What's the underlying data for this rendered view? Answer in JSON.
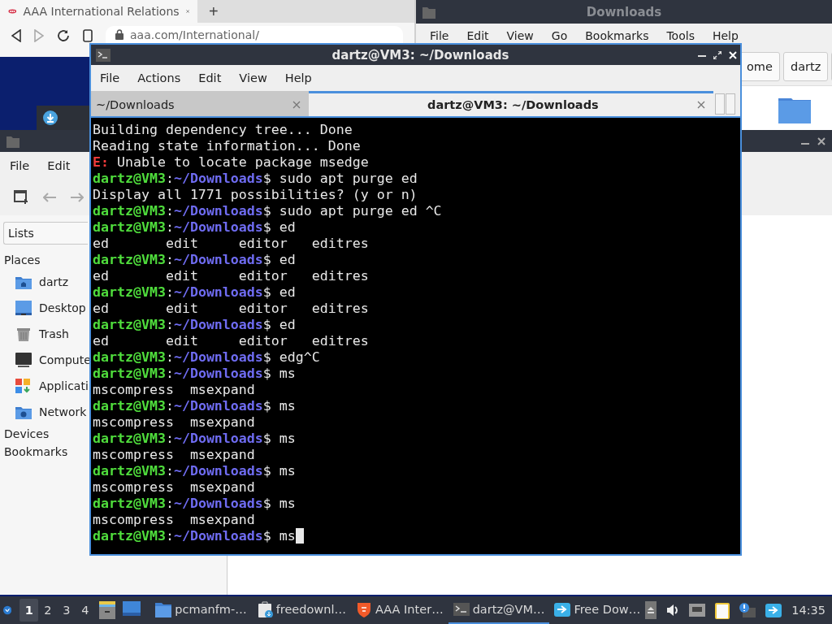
{
  "browser": {
    "tabs": [
      {
        "label": "AAA International Relations",
        "selected": true
      }
    ],
    "new_tab": "+",
    "address": "aaa.com/International/"
  },
  "downloads_window": {
    "title": "Downloads",
    "menu": [
      "File",
      "Edit",
      "View",
      "Go",
      "Bookmarks",
      "Tools",
      "Help"
    ],
    "path_buttons": [
      "ome",
      "dartz"
    ]
  },
  "file_manager": {
    "menu": [
      "File",
      "Edit"
    ],
    "view_selector": "Lists",
    "sidebar": [
      {
        "title": "Places",
        "items": [
          {
            "label": "dartz",
            "kind": "home"
          },
          {
            "label": "Desktop",
            "kind": "desktop"
          },
          {
            "label": "Trash",
            "kind": "trash"
          },
          {
            "label": "Compute",
            "kind": "computer"
          },
          {
            "label": "Applicati",
            "kind": "apps"
          },
          {
            "label": "Network",
            "kind": "network"
          }
        ]
      },
      {
        "title": "Devices"
      },
      {
        "title": "Bookmarks"
      }
    ]
  },
  "terminal": {
    "title": "dartz@VM3: ~/Downloads",
    "menu": [
      "File",
      "Actions",
      "Edit",
      "View",
      "Help"
    ],
    "tabs": [
      {
        "label": "~/Downloads",
        "selected": false
      },
      {
        "label": "dartz@VM3: ~/Downloads",
        "selected": true
      }
    ],
    "lines": [
      {
        "kind": "output",
        "text": "Building dependency tree... Done"
      },
      {
        "kind": "output",
        "text": "Reading state information... Done"
      },
      {
        "kind": "error",
        "prefix": "E:",
        "text": " Unable to locate package msedge"
      },
      {
        "kind": "prompt",
        "user": "dartz@VM3",
        "separator": ":",
        "path": "~/Downloads",
        "command": "$ sudo apt purge ed"
      },
      {
        "kind": "output",
        "text": "Display all 1771 possibilities? (y or n)"
      },
      {
        "kind": "prompt",
        "user": "dartz@VM3",
        "separator": ":",
        "path": "~/Downloads",
        "command": "$ sudo apt purge ed ^C"
      },
      {
        "kind": "prompt",
        "user": "dartz@VM3",
        "separator": ":",
        "path": "~/Downloads",
        "command": "$ ed"
      },
      {
        "kind": "output",
        "text": "ed       edit     editor   editres"
      },
      {
        "kind": "prompt",
        "user": "dartz@VM3",
        "separator": ":",
        "path": "~/Downloads",
        "command": "$ ed"
      },
      {
        "kind": "output",
        "text": "ed       edit     editor   editres"
      },
      {
        "kind": "prompt",
        "user": "dartz@VM3",
        "separator": ":",
        "path": "~/Downloads",
        "command": "$ ed"
      },
      {
        "kind": "output",
        "text": "ed       edit     editor   editres"
      },
      {
        "kind": "prompt",
        "user": "dartz@VM3",
        "separator": ":",
        "path": "~/Downloads",
        "command": "$ ed"
      },
      {
        "kind": "output",
        "text": "ed       edit     editor   editres"
      },
      {
        "kind": "prompt",
        "user": "dartz@VM3",
        "separator": ":",
        "path": "~/Downloads",
        "command": "$ edg^C"
      },
      {
        "kind": "prompt",
        "user": "dartz@VM3",
        "separator": ":",
        "path": "~/Downloads",
        "command": "$ ms"
      },
      {
        "kind": "output",
        "text": "mscompress  msexpand"
      },
      {
        "kind": "prompt",
        "user": "dartz@VM3",
        "separator": ":",
        "path": "~/Downloads",
        "command": "$ ms"
      },
      {
        "kind": "output",
        "text": "mscompress  msexpand"
      },
      {
        "kind": "prompt",
        "user": "dartz@VM3",
        "separator": ":",
        "path": "~/Downloads",
        "command": "$ ms"
      },
      {
        "kind": "output",
        "text": "mscompress  msexpand"
      },
      {
        "kind": "prompt",
        "user": "dartz@VM3",
        "separator": ":",
        "path": "~/Downloads",
        "command": "$ ms"
      },
      {
        "kind": "output",
        "text": "mscompress  msexpand"
      },
      {
        "kind": "prompt",
        "user": "dartz@VM3",
        "separator": ":",
        "path": "~/Downloads",
        "command": "$ ms"
      },
      {
        "kind": "output",
        "text": "mscompress  msexpand"
      },
      {
        "kind": "prompt",
        "user": "dartz@VM3",
        "separator": ":",
        "path": "~/Downloads",
        "command": "$ ms",
        "cursor": true
      }
    ]
  },
  "taskbar": {
    "workspaces": [
      {
        "label": "1",
        "selected": true
      },
      {
        "label": "2",
        "selected": false
      },
      {
        "label": "3",
        "selected": false
      },
      {
        "label": "4",
        "selected": false
      }
    ],
    "tasks": [
      {
        "label": "pcmanfm-…",
        "kind": "folder",
        "selected": false
      },
      {
        "label": "freedownl…",
        "kind": "download",
        "selected": false
      },
      {
        "label": "AAA Inter…",
        "kind": "lion",
        "selected": false
      },
      {
        "label": "dartz@VM…",
        "kind": "terminal",
        "selected": true
      },
      {
        "label": "Free Dow…",
        "kind": "arrow",
        "selected": false
      }
    ],
    "clock": "14:35"
  }
}
